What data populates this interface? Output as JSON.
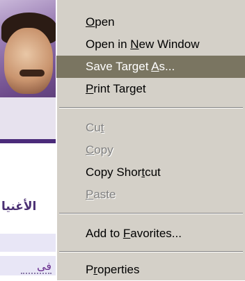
{
  "background": {
    "arabic_heading": "الأغنيا",
    "arabic_link": "فى"
  },
  "menu": {
    "items": [
      {
        "pre": "",
        "key": "O",
        "post": "pen",
        "disabled": false,
        "selected": false
      },
      {
        "pre": "Open in ",
        "key": "N",
        "post": "ew Window",
        "disabled": false,
        "selected": false
      },
      {
        "pre": "Save Target ",
        "key": "A",
        "post": "s...",
        "disabled": false,
        "selected": true
      },
      {
        "pre": "",
        "key": "P",
        "post": "rint Target",
        "disabled": false,
        "selected": false
      },
      {
        "pre": "Cu",
        "key": "t",
        "post": "",
        "disabled": true,
        "selected": false
      },
      {
        "pre": "",
        "key": "C",
        "post": "opy",
        "disabled": true,
        "selected": false
      },
      {
        "pre": "Copy Shor",
        "key": "t",
        "post": "cut",
        "disabled": false,
        "selected": false
      },
      {
        "pre": "",
        "key": "P",
        "post": "aste",
        "disabled": true,
        "selected": false
      },
      {
        "pre": "Add to ",
        "key": "F",
        "post": "avorites...",
        "disabled": false,
        "selected": false
      },
      {
        "pre": "P",
        "key": "r",
        "post": "operties",
        "disabled": false,
        "selected": false
      }
    ]
  },
  "colors": {
    "menu_bg": "#d4d0c8",
    "selected_bg": "#7a7561",
    "disabled_text": "#808080"
  }
}
